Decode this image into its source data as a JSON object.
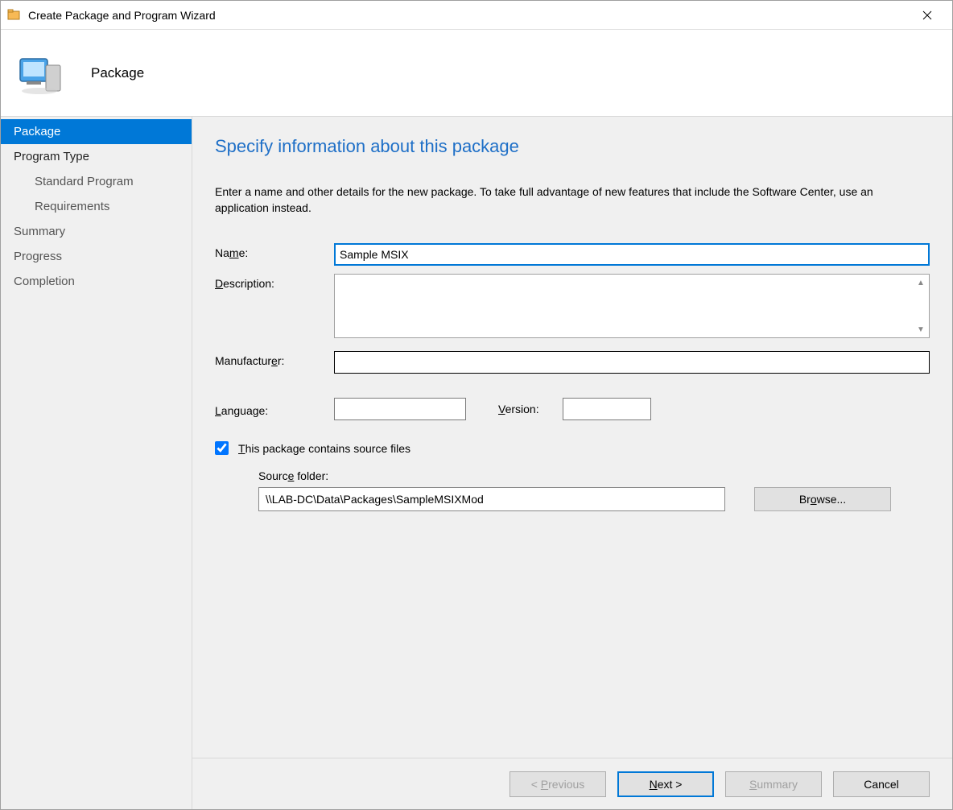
{
  "titlebar": {
    "title": "Create Package and Program Wizard"
  },
  "header": {
    "title": "Package"
  },
  "sidebar": {
    "items": [
      {
        "label": "Package",
        "selected": true
      },
      {
        "label": "Program Type"
      },
      {
        "label": "Standard Program",
        "child": true
      },
      {
        "label": "Requirements",
        "child": true
      },
      {
        "label": "Summary",
        "dim": true
      },
      {
        "label": "Progress",
        "dim": true
      },
      {
        "label": "Completion",
        "dim": true
      }
    ]
  },
  "content": {
    "page_title": "Specify information about this package",
    "instructions": "Enter a name and other details for the new package. To take full advantage of new features that include the Software Center, use an application instead.",
    "labels": {
      "name": "Name:",
      "description": "Description:",
      "manufacturer": "Manufacturer:",
      "language": "Language:",
      "version": "Version:",
      "checkbox": "This package contains source files",
      "source_folder": "Source folder:",
      "browse": "Browse..."
    },
    "values": {
      "name": "Sample MSIX",
      "description": "",
      "manufacturer": "",
      "language": "",
      "version": "",
      "contains_source": true,
      "source_folder": "\\\\LAB-DC\\Data\\Packages\\SampleMSIXMod"
    }
  },
  "footer": {
    "previous": "Previous",
    "next": "Next >",
    "summary": "Summary",
    "cancel": "Cancel"
  }
}
